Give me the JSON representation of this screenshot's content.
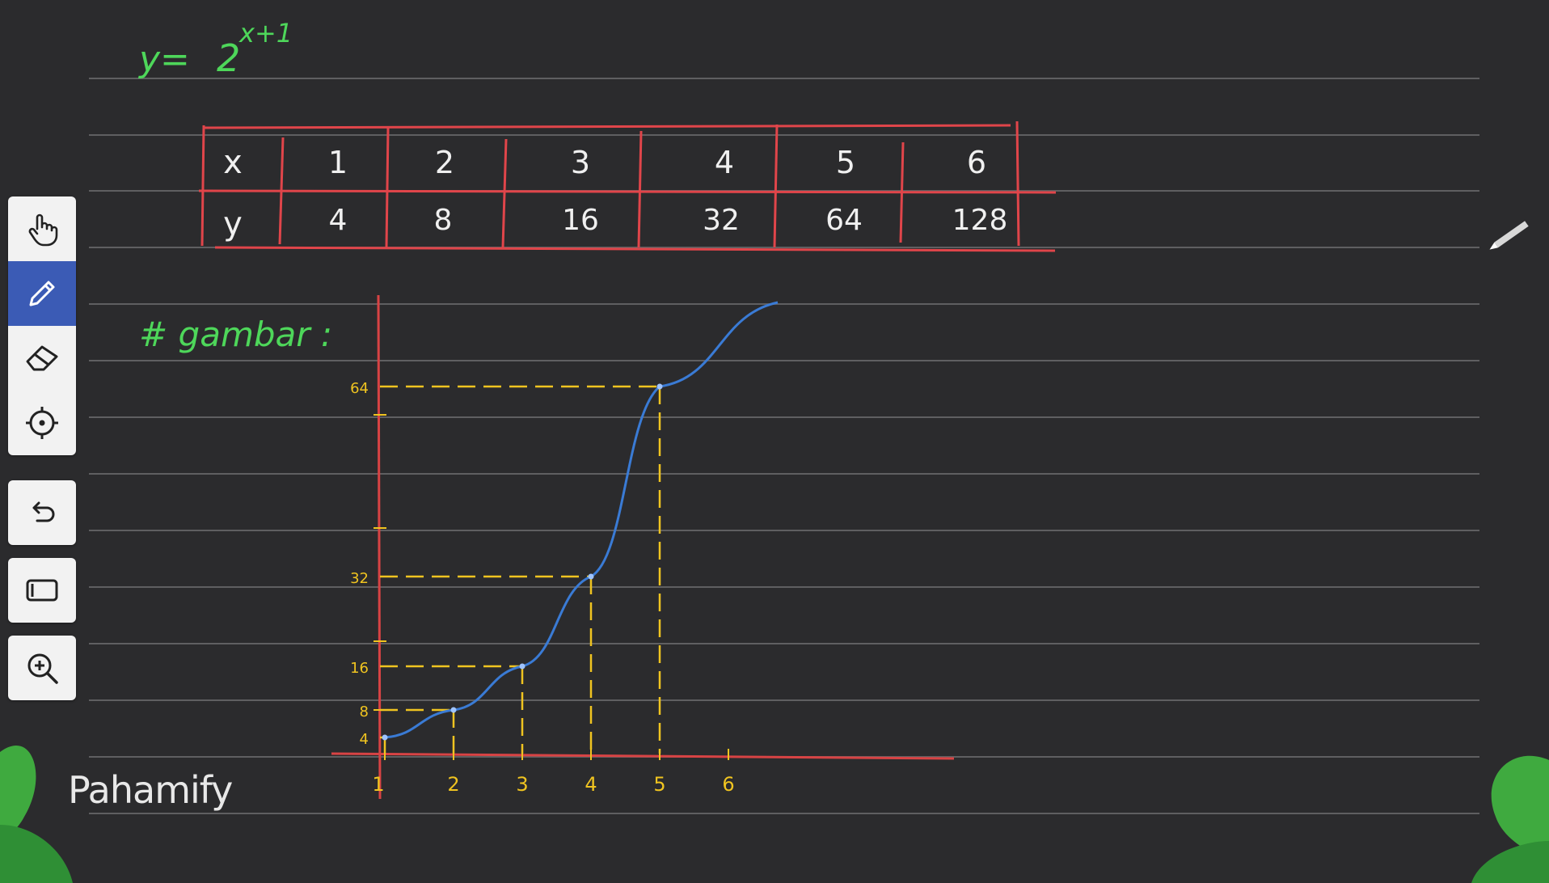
{
  "equation": {
    "lhs": "y=",
    "base": "2",
    "exponent": "x+1"
  },
  "table": {
    "x_label": "x",
    "y_label": "y",
    "x_values": [
      "1",
      "2",
      "3",
      "4",
      "5",
      "6"
    ],
    "y_values": [
      "4",
      "8",
      "16",
      "32",
      "64",
      "128"
    ]
  },
  "section_heading": "# gambar :",
  "chart_data": {
    "type": "line",
    "x": [
      1,
      2,
      3,
      4,
      5
    ],
    "series": [
      {
        "values": [
          4,
          8,
          16,
          32,
          64
        ]
      }
    ],
    "x_tick_labels": [
      "1",
      "2",
      "3",
      "4",
      "5",
      "6"
    ],
    "y_tick_labels": [
      "4",
      "8",
      "16",
      "32",
      "64"
    ],
    "guide_lines": "dashed yellow",
    "curve_color": "#3a7bd5"
  },
  "brand": {
    "name": "Pahamify"
  },
  "toolbar": {
    "tools": [
      "hand-icon",
      "pen-icon",
      "eraser-icon",
      "laser-pointer-icon"
    ],
    "active_tool": "pen-icon",
    "extra": [
      "undo-icon",
      "fullscreen-icon",
      "zoom-in-icon"
    ]
  },
  "colors": {
    "background": "#2b2b2d",
    "ruled_lines": "#6a6a6c",
    "handwriting_green": "#4ed75a",
    "table_red": "#e0454a",
    "table_text": "#f0f0f0",
    "axis_red": "#d84344",
    "guide_yellow": "#f0c420",
    "curve_blue": "#3a7bd5",
    "active_tool": "#3b5bb5"
  }
}
